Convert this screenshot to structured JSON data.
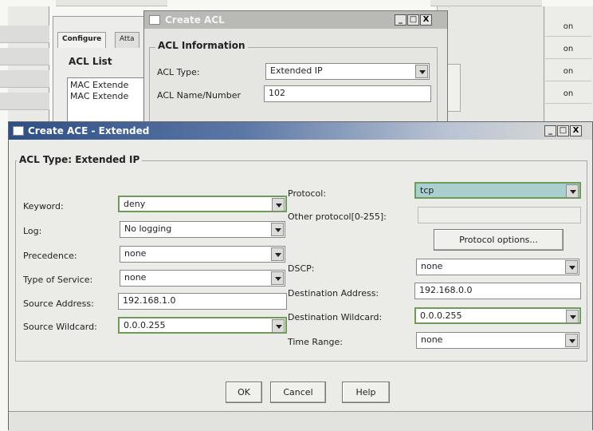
{
  "background": {
    "tabs": [
      "Configure",
      "Atta"
    ],
    "acl_list_title": "ACL List",
    "acl_list_items": [
      "MAC Extende",
      "MAC Extende"
    ],
    "right_column": [
      "on",
      "on",
      "on",
      "on"
    ]
  },
  "acl_dialog": {
    "title": "Create ACL",
    "controls": [
      "_",
      "□",
      "X"
    ],
    "group_title": "ACL Information",
    "acl_type_label": "ACL Type:",
    "acl_type_value": "Extended IP",
    "acl_name_label": "ACL Name/Number",
    "acl_name_value": "102"
  },
  "ace_dialog": {
    "title": "Create ACE - Extended",
    "controls": [
      "_",
      "□",
      "X"
    ],
    "group_title": "ACL Type: Extended IP",
    "left": {
      "keyword_label": "Keyword:",
      "keyword_value": "deny",
      "log_label": "Log:",
      "log_value": "No logging",
      "precedence_label": "Precedence:",
      "precedence_value": "none",
      "tos_label": "Type of Service:",
      "tos_value": "none",
      "source_address_label": "Source Address:",
      "source_address_value": "192.168.1.0",
      "source_wildcard_label": "Source Wildcard:",
      "source_wildcard_value": "0.0.0.255"
    },
    "right": {
      "protocol_label": "Protocol:",
      "protocol_value": "tcp",
      "other_protocol_label": "Other protocol[0-255]:",
      "other_protocol_value": "",
      "protocol_options_label": "Protocol options...",
      "dscp_label": "DSCP:",
      "dscp_value": "none",
      "dest_address_label": "Destination Address:",
      "dest_address_value": "192.168.0.0",
      "dest_wildcard_label": "Destination Wildcard:",
      "dest_wildcard_value": "0.0.0.255",
      "time_range_label": "Time Range:",
      "time_range_value": "none"
    },
    "buttons": {
      "ok": "OK",
      "cancel": "Cancel",
      "help": "Help"
    }
  },
  "colors": {
    "field_highlight": "#6e9a5a",
    "protocol_bg": "#a9cfcf",
    "active_title": "#2e4f86"
  }
}
